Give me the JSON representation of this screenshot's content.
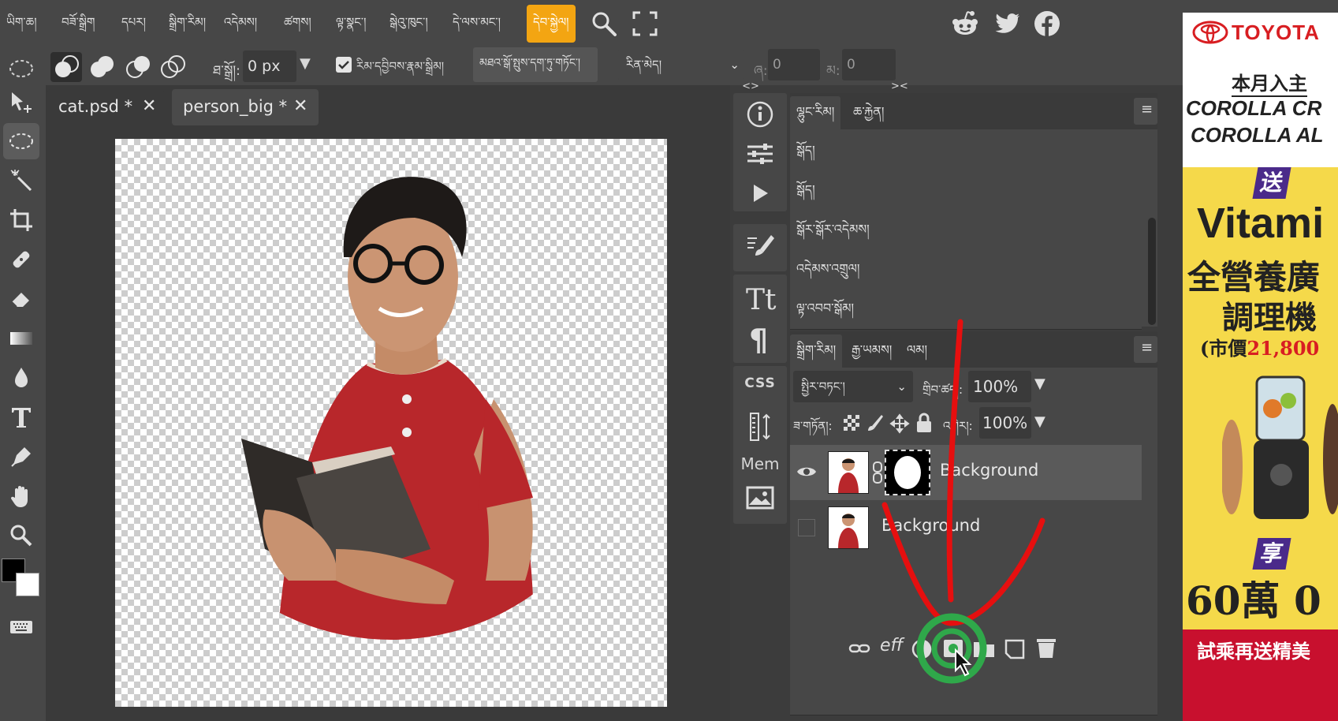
{
  "menu": {
    "items": [
      "ཡིག་ཆ།",
      "བཟོ་སྒྲིག",
      "དཔར།",
      "སྒྲིག་རིམ།",
      "འདེམས།",
      "ཚགས།",
      "ལྟ་སྣང་།",
      "སྒེའུ་ཁུང་།",
      "དེ་ལས་མང་།",
      "དེབ་སྐྱེལ།"
    ],
    "active_index": 9,
    "right_icons": [
      "reddit-icon",
      "twitter-icon",
      "facebook-icon"
    ]
  },
  "options": {
    "feather_label": "ཐ་སྒྲོ།:",
    "feather_value": "0 px",
    "antialias_label": "རིམ་དབྱིབས་རྣམ་སྒྲིམ།",
    "refine_button": "མཐའ་སྒོ་སྤུས་དག་ཏུ་གཏོང་།",
    "mode_value": "རིན་མེད།",
    "w_label": "ཞ:",
    "w_value": "0",
    "h_label": "མ:",
    "h_value": "0"
  },
  "tabs": [
    {
      "name": "cat.psd *",
      "close": "✕"
    },
    {
      "name": "person_big *",
      "close": "✕"
    }
  ],
  "side_strip": {
    "collapse_left": "<>",
    "collapse_right": "><",
    "css_label": "CSS",
    "mem_label": "Mem"
  },
  "history_panel": {
    "tabs": [
      "ལྷུང་རིམ།",
      "ཆ་རྐྱེན།"
    ],
    "menu_icon": "≡",
    "items": [
      "སྒོད།",
      "སྒོད།",
      "སྒོར་སྒོར་འདེམས།",
      "འདེམས་འགྲུལ།",
      "ལྟ་འབབ་སྒོམ།"
    ]
  },
  "layers_panel": {
    "tabs": [
      "སྒྲིག་རིམ།",
      "རྒྱ་ཡམས།",
      "ལམ།"
    ],
    "menu_icon": "≡",
    "blend_mode": "སྤྱིར་བཏང་།",
    "opacity_label": "གྲིབ་ཚད།:",
    "opacity_value": "100%",
    "lock_label": "ཟ་གཏོན།:",
    "fill_label": "འགེར།:",
    "fill_value": "100%",
    "layers": [
      {
        "name": "Background",
        "visible": true,
        "selected": true,
        "has_mask": true
      },
      {
        "name": "Background",
        "visible": false,
        "selected": false,
        "has_mask": false
      }
    ],
    "footer_eff": "eff"
  },
  "ad": {
    "brand": "TOYOTA",
    "line1": "本月入主",
    "line2": "COROLLA CR",
    "line3": "COROLLA AL",
    "badge1": "送",
    "line4": "Vitami",
    "line5": "全營養廣",
    "line6": "調理機",
    "price_prefix": "(市價",
    "price_value": "21,800",
    "badge2": "享",
    "line7": "60萬 0",
    "footer": "試乘再送精美"
  },
  "colors": {
    "accent": "#f3a512",
    "annotation_red": "#e60f0f",
    "annotation_green": "#2fa84a"
  }
}
